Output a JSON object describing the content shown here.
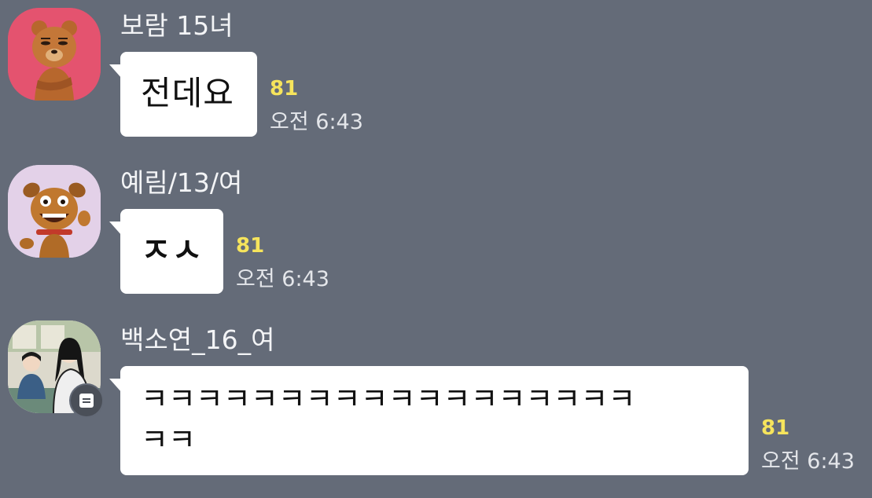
{
  "colors": {
    "background": "#646b78",
    "bubble": "#ffffff",
    "unread": "#f6e45c",
    "sender_text": "#f3f4f6",
    "time_text": "#e4e6ea"
  },
  "messages": [
    {
      "sender": "보람 15녀",
      "avatar_icon": "brown-bear-character-avatar",
      "text": "전데요",
      "unread_count": "81",
      "time": "오전 6:43"
    },
    {
      "sender": "예림/13/여",
      "avatar_icon": "brown-dog-character-avatar",
      "text": "ㅈㅅ",
      "unread_count": "81",
      "time": "오전 6:43"
    },
    {
      "sender": "백소연_16_여",
      "avatar_icon": "illustrated-couple-avatar",
      "text": "ㅋㅋㅋㅋㅋㅋㅋㅋㅋㅋㅋㅋㅋㅋㅋㅋㅋㅋ\nㅋㅋ",
      "unread_count": "81",
      "time": "오전 6:43",
      "badge_icon": "document-badge-icon"
    }
  ]
}
